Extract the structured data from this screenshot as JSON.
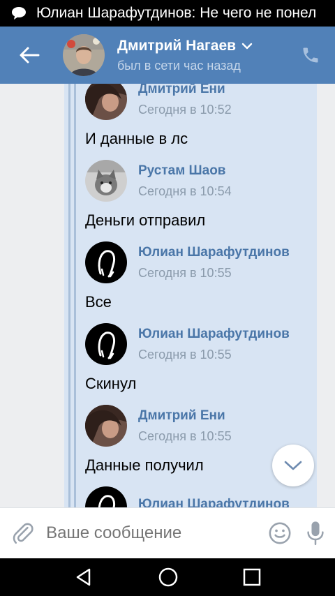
{
  "status_bar": {
    "notification_text": "Юлиан Шарафутдинов: Не чего не понел"
  },
  "header": {
    "contact_name": "Дмитрий Нагаев",
    "last_seen": "был в сети час назад"
  },
  "forwarded_messages": [
    {
      "author": "Дмитрий Ени",
      "time": "Сегодня в 10:52",
      "text": "И данные в лс",
      "avatar": "photo-dark-hair"
    },
    {
      "author": "Рустам Шаов",
      "time": "Сегодня в 10:54",
      "text": "Деньги отправил",
      "avatar": "photo-gray-cat"
    },
    {
      "author": "Юлиан Шарафутдинов",
      "time": "Сегодня в 10:55",
      "text": "Все",
      "avatar": "black-white-logo"
    },
    {
      "author": "Юлиан Шарафутдинов",
      "time": "Сегодня в 10:55",
      "text": "Скинул",
      "avatar": "black-white-logo"
    },
    {
      "author": "Дмитрий Ени",
      "time": "Сегодня в 10:55",
      "text": "Данные получил",
      "avatar": "photo-dark-hair"
    },
    {
      "author": "Юлиан Шарафутдинов",
      "time": "",
      "text": "",
      "avatar": "black-white-logo"
    }
  ],
  "composer": {
    "placeholder": "Ваше сообщение"
  },
  "colors": {
    "header_bg": "#5181b8",
    "forward_panel_bg": "#d8e4f3",
    "author_link": "#4a76a8",
    "timestamp": "#8a9aab"
  },
  "icons": {
    "status": "speech-bubble-icon",
    "back": "arrow-left-icon",
    "dropdown": "chevron-down-icon",
    "call": "phone-icon",
    "scroll": "chevron-down-icon",
    "attach": "paperclip-icon",
    "emoji": "smiley-icon",
    "voice": "microphone-icon",
    "nav_back": "triangle-back-icon",
    "nav_home": "circle-home-icon",
    "nav_recents": "square-recents-icon"
  }
}
